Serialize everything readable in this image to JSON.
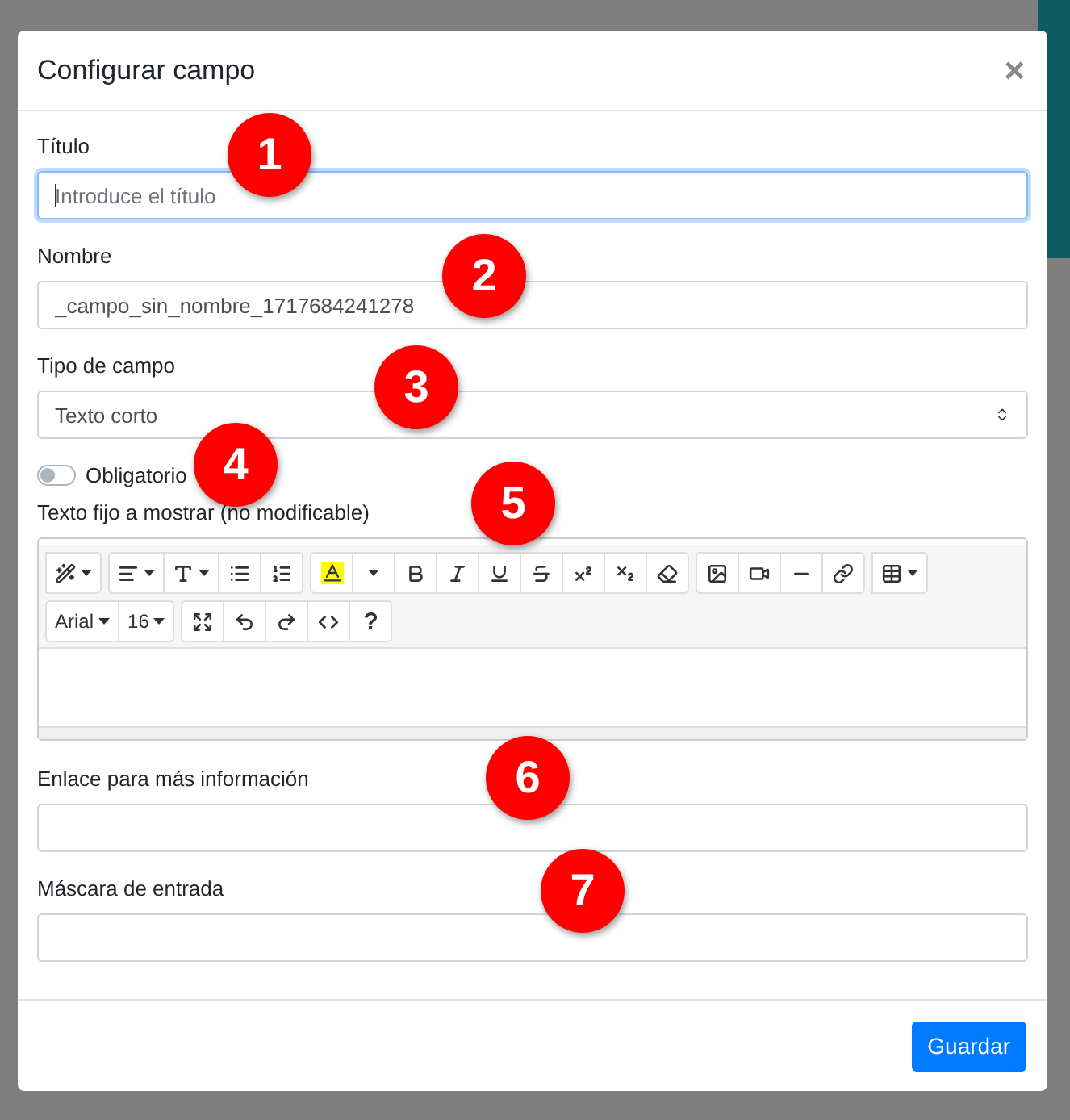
{
  "dialog": {
    "title": "Configurar campo",
    "close": "×"
  },
  "fields": [
    {
      "kind": "text",
      "label": "Título",
      "placeholder": "Introduce el título",
      "focused": true
    },
    {
      "kind": "text",
      "label": "Nombre",
      "value": "_campo_sin_nombre_1717684241278"
    },
    {
      "kind": "select",
      "label": "Tipo de campo",
      "value": "Texto corto"
    },
    {
      "kind": "switch",
      "label": "Obligatorio",
      "on": false
    },
    {
      "kind": "editor",
      "label": "Texto fijo a mostrar (no modificable)",
      "font": "Arial",
      "size": "16",
      "help": "?"
    },
    {
      "kind": "text",
      "label": "Enlace para más información"
    },
    {
      "kind": "text",
      "label": "Máscara de entrada"
    }
  ],
  "markers": [
    {
      "label": "1"
    },
    {
      "label": "2"
    },
    {
      "label": "3"
    },
    {
      "label": "4"
    },
    {
      "label": "5"
    },
    {
      "label": "6"
    },
    {
      "label": "7"
    }
  ],
  "footer": {
    "button": "Guardar"
  }
}
